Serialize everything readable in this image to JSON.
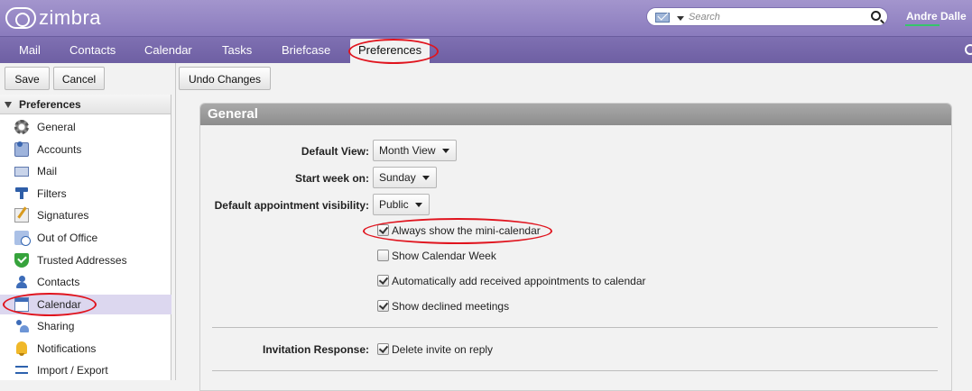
{
  "header": {
    "logo_text": "zimbra",
    "search_placeholder": "Search",
    "user_name": "Andre Dalle"
  },
  "app_tabs": [
    {
      "label": "Mail"
    },
    {
      "label": "Contacts"
    },
    {
      "label": "Calendar"
    },
    {
      "label": "Tasks"
    },
    {
      "label": "Briefcase"
    },
    {
      "label": "Preferences",
      "active": true
    }
  ],
  "toolbar": {
    "save_label": "Save",
    "cancel_label": "Cancel",
    "undo_label": "Undo Changes"
  },
  "sidebar": {
    "header": "Preferences",
    "items": [
      {
        "label": "General",
        "icon": "gear-icon"
      },
      {
        "label": "Accounts",
        "icon": "accounts-icon"
      },
      {
        "label": "Mail",
        "icon": "envelope-icon"
      },
      {
        "label": "Filters",
        "icon": "filter-icon"
      },
      {
        "label": "Signatures",
        "icon": "signature-icon"
      },
      {
        "label": "Out of Office",
        "icon": "out-of-office-icon"
      },
      {
        "label": "Trusted Addresses",
        "icon": "shield-icon"
      },
      {
        "label": "Contacts",
        "icon": "contacts-icon"
      },
      {
        "label": "Calendar",
        "icon": "calendar-icon",
        "selected": true
      },
      {
        "label": "Sharing",
        "icon": "sharing-icon"
      },
      {
        "label": "Notifications",
        "icon": "bell-icon"
      },
      {
        "label": "Import / Export",
        "icon": "import-export-icon"
      }
    ]
  },
  "panel": {
    "title": "General",
    "default_view": {
      "label": "Default View:",
      "value": "Month View"
    },
    "start_week": {
      "label": "Start week on:",
      "value": "Sunday"
    },
    "visibility": {
      "label": "Default appointment visibility:",
      "value": "Public"
    },
    "checkboxes": [
      {
        "label": "Always show the mini-calendar",
        "checked": true
      },
      {
        "label": "Show Calendar Week",
        "checked": false
      },
      {
        "label": "Automatically add received appointments to calendar",
        "checked": true
      },
      {
        "label": "Show declined meetings",
        "checked": true
      }
    ],
    "invitation": {
      "label": "Invitation Response:",
      "checkbox_label": "Delete invite on reply",
      "checked": true
    }
  },
  "colors": {
    "header_purple": "#8a7bbd",
    "tab_purple": "#6e5fa3",
    "annotation_red": "#e0141e",
    "selection": "#dcd7ef"
  }
}
